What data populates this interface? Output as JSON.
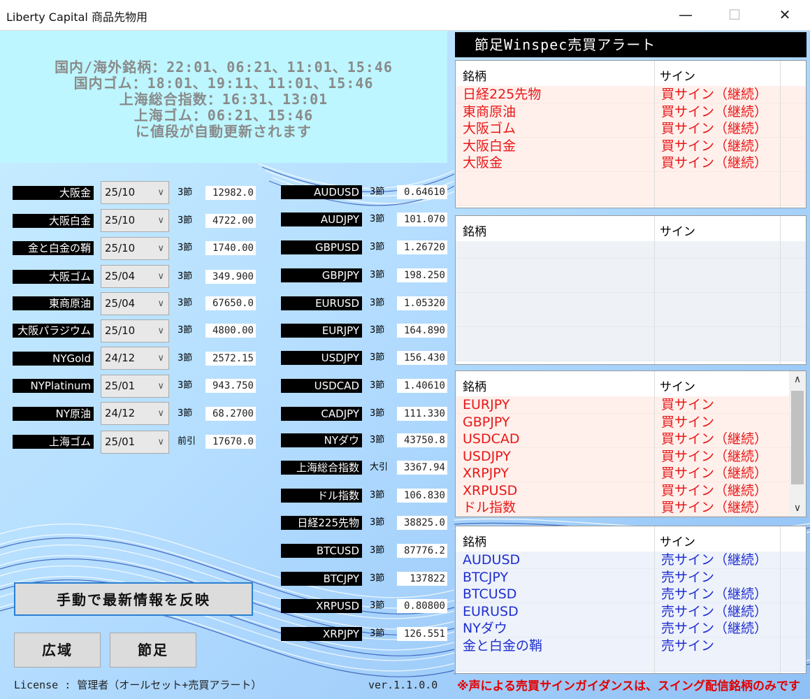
{
  "window": {
    "title": "Liberty Capital 商品先物用",
    "minimize": "—",
    "maximize": "☐",
    "close": "✕"
  },
  "info": {
    "lines": [
      "国内/海外銘柄：22:01、06:21、11:01、15:46",
      "国内ゴム：18:01、19:11、11:01、15:46",
      "上海総合指数：16:31、13:01",
      "上海ゴム：06:21、15:46",
      "に値段が自動更新されます"
    ]
  },
  "left_items": [
    {
      "label": "大阪金",
      "month": "25/10",
      "tf": "3節",
      "price": "12982.0"
    },
    {
      "label": "大阪白金",
      "month": "25/10",
      "tf": "3節",
      "price": "4722.00"
    },
    {
      "label": "金と白金の鞘",
      "month": "25/10",
      "tf": "3節",
      "price": "1740.00"
    },
    {
      "label": "大阪ゴム",
      "month": "25/04",
      "tf": "3節",
      "price": "349.900"
    },
    {
      "label": "東商原油",
      "month": "25/04",
      "tf": "3節",
      "price": "67650.0"
    },
    {
      "label": "大阪パラジウム",
      "month": "25/10",
      "tf": "3節",
      "price": "4800.00"
    },
    {
      "label": "NYGold",
      "month": "24/12",
      "tf": "3節",
      "price": "2572.15"
    },
    {
      "label": "NYPlatinum",
      "month": "25/01",
      "tf": "3節",
      "price": "943.750"
    },
    {
      "label": "NY原油",
      "month": "24/12",
      "tf": "3節",
      "price": "68.2700"
    },
    {
      "label": "上海ゴム",
      "month": "25/01",
      "tf": "前引",
      "price": "17670.0"
    }
  ],
  "right_items": [
    {
      "label": "AUDUSD",
      "tf": "3節",
      "price": "0.64610"
    },
    {
      "label": "AUDJPY",
      "tf": "3節",
      "price": "101.070"
    },
    {
      "label": "GBPUSD",
      "tf": "3節",
      "price": "1.26720"
    },
    {
      "label": "GBPJPY",
      "tf": "3節",
      "price": "198.250"
    },
    {
      "label": "EURUSD",
      "tf": "3節",
      "price": "1.05320"
    },
    {
      "label": "EURJPY",
      "tf": "3節",
      "price": "164.890"
    },
    {
      "label": "USDJPY",
      "tf": "3節",
      "price": "156.430"
    },
    {
      "label": "USDCAD",
      "tf": "3節",
      "price": "1.40610"
    },
    {
      "label": "CADJPY",
      "tf": "3節",
      "price": "111.330"
    },
    {
      "label": "NYダウ",
      "tf": "3節",
      "price": "43750.8"
    },
    {
      "label": "上海総合指数",
      "tf": "大引",
      "price": "3367.94"
    },
    {
      "label": "ドル指数",
      "tf": "3節",
      "price": "106.830"
    },
    {
      "label": "日経225先物",
      "tf": "3節",
      "price": "38825.0"
    },
    {
      "label": "BTCUSD",
      "tf": "3節",
      "price": "87776.2"
    },
    {
      "label": "BTCJPY",
      "tf": "3節",
      "price": "137822"
    },
    {
      "label": "XRPUSD",
      "tf": "3節",
      "price": "0.80800"
    },
    {
      "label": "XRPJPY",
      "tf": "3節",
      "price": "126.551"
    }
  ],
  "buttons": {
    "manual_update": "手動で最新情報を反映",
    "wide": "広域",
    "setsuashi": "節足"
  },
  "footer": {
    "license": "License : 管理者（オールセット+売買アラート）",
    "version": "ver.1.1.0.0",
    "note": "※声による売買サインガイダンスは、スイング配信銘柄のみです"
  },
  "alerts": {
    "header": "節足Winspec売買アラート",
    "col_name": "銘柄",
    "col_sign": "サイン",
    "colors": {
      "buy": "#e81818",
      "sell": "#1f2fd0",
      "buy_bg": "#fff0ec",
      "sell_bg": "#eef2fa",
      "empty_bg": "#eef2f7"
    },
    "table1": [
      {
        "name": "日経225先物",
        "sign": "買サイン（継続）"
      },
      {
        "name": "東商原油",
        "sign": "買サイン（継続）"
      },
      {
        "name": "大阪ゴム",
        "sign": "買サイン（継続）"
      },
      {
        "name": "大阪白金",
        "sign": "買サイン（継続）"
      },
      {
        "name": "大阪金",
        "sign": "買サイン（継続）"
      }
    ],
    "table2": [],
    "table3": [
      {
        "name": "EURJPY",
        "sign": "買サイン"
      },
      {
        "name": "GBPJPY",
        "sign": "買サイン"
      },
      {
        "name": "USDCAD",
        "sign": "買サイン（継続）"
      },
      {
        "name": "USDJPY",
        "sign": "買サイン（継続）"
      },
      {
        "name": "XRPJPY",
        "sign": "買サイン（継続）"
      },
      {
        "name": "XRPUSD",
        "sign": "買サイン（継続）"
      },
      {
        "name": "ドル指数",
        "sign": "買サイン（継続）"
      }
    ],
    "table4": [
      {
        "name": "AUDUSD",
        "sign": "売サイン（継続）"
      },
      {
        "name": "BTCJPY",
        "sign": "売サイン"
      },
      {
        "name": "BTCUSD",
        "sign": "売サイン（継続）"
      },
      {
        "name": "EURUSD",
        "sign": "売サイン（継続）"
      },
      {
        "name": "NYダウ",
        "sign": "売サイン（継続）"
      },
      {
        "name": "金と白金の鞘",
        "sign": "売サイン"
      }
    ],
    "scroll_up_icon": "chevron-up-icon",
    "scroll_down_icon": "chevron-down-icon"
  }
}
